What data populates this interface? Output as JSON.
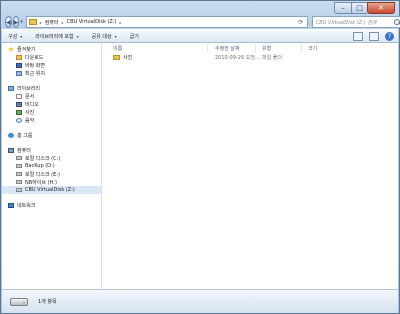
{
  "window": {
    "controls": {
      "minimize": "–",
      "maximize": "□",
      "close": "✕"
    }
  },
  "address_bar": {
    "crumbs": [
      "컴퓨터",
      "CBU VirtualDisk (Z:)"
    ],
    "arrow": "▸",
    "back": "◀",
    "forward": "▶",
    "dropdown": "▾",
    "refresh": "⟳"
  },
  "search": {
    "placeholder": "CBU VirtualDisk (Z:) 검색"
  },
  "toolbar": {
    "items": [
      {
        "label": "구성",
        "dropdown": "▾"
      },
      {
        "label": "라이브러리에 포함",
        "dropdown": "▾"
      },
      {
        "label": "공유 대상",
        "dropdown": "▾"
      },
      {
        "label": "굽기"
      }
    ],
    "help": "?"
  },
  "nav": {
    "favorites": {
      "label": "즐겨찾기",
      "items": [
        "다운로드",
        "바탕 화면",
        "최근 위치"
      ]
    },
    "libraries": {
      "label": "라이브러리",
      "items": [
        "문서",
        "비디오",
        "사진",
        "음악"
      ]
    },
    "homegroup": {
      "label": "홈 그룹"
    },
    "computer": {
      "label": "컴퓨터",
      "items": [
        "로컬 디스크 (C:)",
        "BacKup (D:)",
        "로컬 디스크 (E:)",
        "NB하이브 (H:)",
        "CBU VirtualDisk (Z:)"
      ],
      "selected_index": 4
    },
    "network": {
      "label": "네트워크"
    }
  },
  "columns": {
    "name": "이름",
    "date": "수정한 날짜",
    "type": "유형",
    "size": "크기"
  },
  "files": [
    {
      "name": "사진",
      "date": "2010-09-26 오전...",
      "type": "파일 폴더",
      "size": ""
    }
  ],
  "status": {
    "text": "1개 항목"
  },
  "icons": {
    "favorites": "star-icon",
    "folder": "folder-icon",
    "drive": "drive-icon",
    "network": "network-icon"
  }
}
